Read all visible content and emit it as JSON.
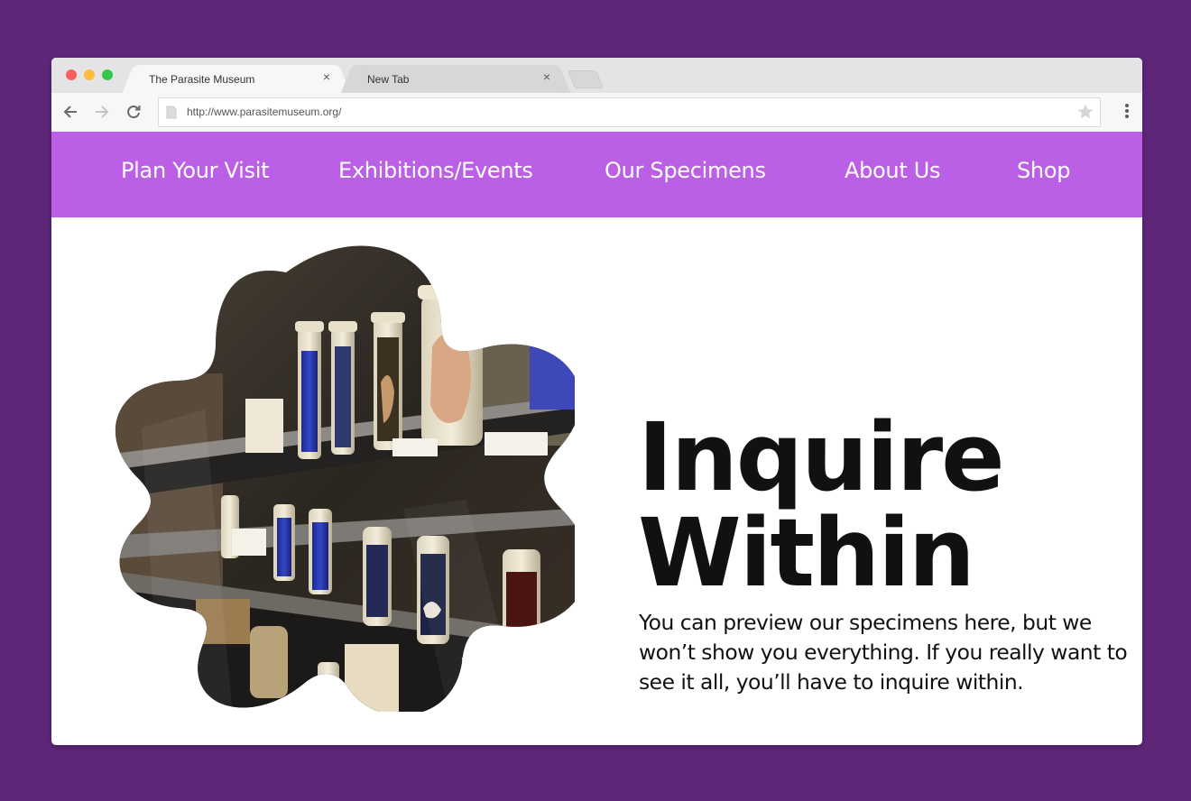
{
  "browser": {
    "tabs": [
      {
        "title": "The Parasite Museum",
        "active": true
      },
      {
        "title": "New Tab",
        "active": false
      }
    ],
    "url": "http://www.parasitemuseum.org/",
    "icons": {
      "back": "arrow-left-icon",
      "forward": "arrow-right-icon",
      "reload": "reload-icon",
      "page": "document-icon",
      "bookmark": "star-icon",
      "menu": "vertical-dots-icon"
    }
  },
  "site": {
    "nav": [
      "Plan Your Visit",
      "Exhibitions/Events",
      "Our Specimens",
      "About Us",
      "Shop"
    ],
    "headline_line1": "Inquire",
    "headline_line2": "Within",
    "body": "You can preview our specimens here, but we won’t show you everything. If you  really want to see it all, you’ll have to inquire within.",
    "image_subject": "museum display case with specimen jars"
  },
  "colors": {
    "backdrop": "#5e2677",
    "nav_bar": "#bb5fe6",
    "nav_text": "#ffffff",
    "headline": "#111111"
  }
}
